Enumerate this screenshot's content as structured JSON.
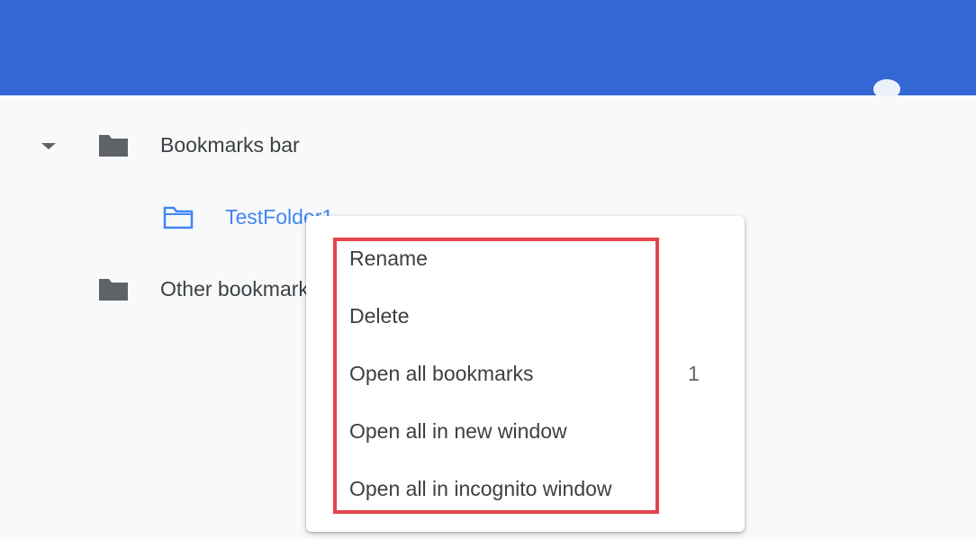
{
  "tree": {
    "bookmarks_bar_label": "Bookmarks bar",
    "test_folder_label": "TestFolder1",
    "other_bookmarks_label": "Other bookmarks"
  },
  "context_menu": {
    "items": [
      {
        "label": "Rename"
      },
      {
        "label": "Delete"
      },
      {
        "label": "Open all bookmarks"
      },
      {
        "label": "Open all in new window"
      },
      {
        "label": "Open all in incognito window"
      }
    ],
    "open_all_count": "1"
  },
  "colors": {
    "header": "#3367d6",
    "highlight": "#e5444a",
    "selected_folder": "#4285f4"
  }
}
